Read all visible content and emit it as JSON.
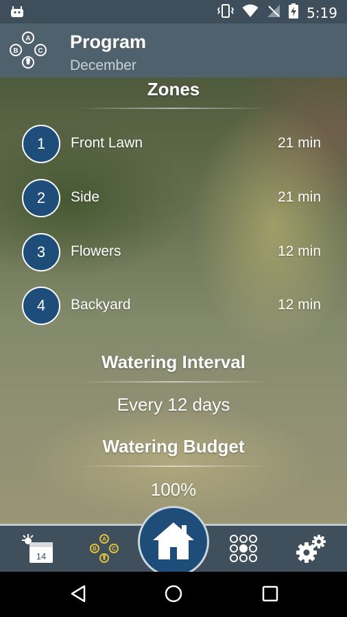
{
  "status_bar": {
    "time": "5:19"
  },
  "app_bar": {
    "title": "Program",
    "subtitle": "December"
  },
  "zones_section": {
    "title": "Zones"
  },
  "zones": [
    {
      "number": "1",
      "name": "Front Lawn",
      "duration": "21 min"
    },
    {
      "number": "2",
      "name": "Side",
      "duration": "21 min"
    },
    {
      "number": "3",
      "name": "Flowers",
      "duration": "12 min"
    },
    {
      "number": "4",
      "name": "Backyard",
      "duration": "12 min"
    }
  ],
  "watering_interval": {
    "title": "Watering Interval",
    "value": "Every 12 days"
  },
  "watering_budget": {
    "title": "Watering Budget",
    "value": "100%"
  },
  "bottom_nav": {
    "calendar_icon_day": "14",
    "tabs": [
      "calendar-weather",
      "program",
      "home",
      "zones-grid",
      "settings"
    ],
    "active_tab": "program"
  },
  "colors": {
    "status_bar": "#3e4e5a",
    "app_bar": "#50616e",
    "accent_blue": "#1f4d7a",
    "program_icon_active": "#e2c13a"
  }
}
